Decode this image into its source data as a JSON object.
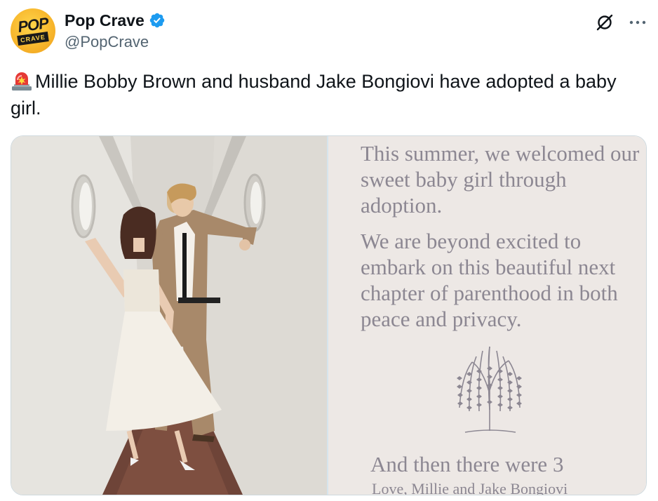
{
  "author": {
    "display_name": "Pop Crave",
    "handle": "@PopCrave",
    "avatar_text_top": "POP",
    "avatar_text_bottom": "CRAVE",
    "verified": true,
    "verified_color": "#1d9bf0"
  },
  "header_icons": [
    "grok-icon",
    "more-icon"
  ],
  "tweet": {
    "emoji": "siren-icon",
    "text": "Millie Bobby Brown and husband Jake Bongiovi have adopted a baby girl."
  },
  "media": {
    "photo_icon": "photo",
    "announcement": {
      "paragraph_1": "This summer, we welcomed our sweet baby girl through adoption.",
      "paragraph_2": "We are beyond excited to embark on this beautiful next chapter of parenthood in both peace and privacy.",
      "closing": "And then there were 3",
      "signoff": "Love, Millie and Jake Bongiovi",
      "illustration_icon": "willow-tree-icon"
    }
  },
  "colors": {
    "text_primary": "#0f1419",
    "text_secondary": "#536471",
    "announcement_bg": "#ede8e5",
    "announcement_text": "#8c8792"
  }
}
